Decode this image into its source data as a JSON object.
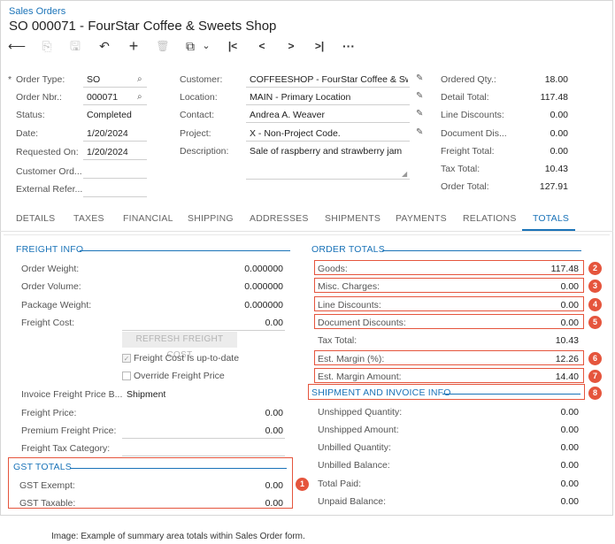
{
  "header": {
    "breadcrumb": "Sales Orders",
    "title": "SO 000071 - FourStar Coffee & Sweets Shop"
  },
  "toolbar": {
    "icons": [
      "back-icon",
      "save-close-icon",
      "save-icon",
      "undo-icon",
      "add-icon",
      "delete-icon",
      "copy-icon",
      "first-icon",
      "previous-icon",
      "next-icon",
      "last-icon",
      "more-icon"
    ],
    "back": "⟵",
    "save_close": "⎘",
    "save": "🖫",
    "undo": "↶",
    "add": "+",
    "delete": "🗑",
    "copy": "⧉",
    "copy_dd": "⌄",
    "first": "|<",
    "prev": "<",
    "next": ">",
    "last": ">|",
    "more": "···"
  },
  "summary": {
    "required_mark": "*",
    "order_type_label": "Order Type:",
    "order_type": "SO",
    "order_nbr_label": "Order Nbr.:",
    "order_nbr": "000071",
    "status_label": "Status:",
    "status": "Completed",
    "date_label": "Date:",
    "date": "1/20/2024",
    "requested_on_label": "Requested On:",
    "requested_on": "1/20/2024",
    "customer_ord_label": "Customer Ord...",
    "external_refer_label": "External Refer...",
    "customer_label": "Customer:",
    "customer": "COFFEESHOP - FourStar Coffee & Swee",
    "location_label": "Location:",
    "location": "MAIN - Primary Location",
    "contact_label": "Contact:",
    "contact": "Andrea A. Weaver",
    "project_label": "Project:",
    "project": "X - Non-Project Code.",
    "description_label": "Description:",
    "description": "Sale of raspberry and strawberry jam",
    "ordered_qty_label": "Ordered Qty.:",
    "ordered_qty": "18.00",
    "detail_total_label": "Detail Total:",
    "detail_total": "117.48",
    "line_discounts_label": "Line Discounts:",
    "line_discounts": "0.00",
    "document_dis_label": "Document Dis...",
    "document_dis": "0.00",
    "freight_total_label": "Freight Total:",
    "freight_total": "0.00",
    "tax_total_label": "Tax Total:",
    "tax_total": "10.43",
    "order_total_label": "Order Total:",
    "order_total": "127.91"
  },
  "tabs": [
    "DETAILS",
    "TAXES",
    "FINANCIAL",
    "SHIPPING",
    "ADDRESSES",
    "SHIPMENTS",
    "PAYMENTS",
    "RELATIONS",
    "TOTALS"
  ],
  "freight": {
    "title": "FREIGHT INFO",
    "order_weight_label": "Order Weight:",
    "order_weight": "0.000000",
    "order_volume_label": "Order Volume:",
    "order_volume": "0.000000",
    "package_weight_label": "Package Weight:",
    "package_weight": "0.000000",
    "freight_cost_label": "Freight Cost:",
    "freight_cost": "0.00",
    "refresh_label": "REFRESH FREIGHT COST",
    "uptodate_label": "Freight Cost Is up-to-date",
    "uptodate_mark": "✓",
    "override_label": "Override Freight Price",
    "invoice_price_label": "Invoice Freight Price B...",
    "invoice_price": "Shipment",
    "freight_price_label": "Freight Price:",
    "freight_price": "0.00",
    "premium_price_label": "Premium Freight Price:",
    "premium_price": "0.00",
    "tax_category_label": "Freight Tax Category:"
  },
  "gst": {
    "title": "GST TOTALS",
    "exempt_label": "GST Exempt:",
    "exempt": "0.00",
    "taxable_label": "GST Taxable:",
    "taxable": "0.00"
  },
  "order_totals": {
    "title": "ORDER TOTALS",
    "goods_label": "Goods:",
    "goods": "117.48",
    "misc_label": "Misc. Charges:",
    "misc": "0.00",
    "line_disc_label": "Line Discounts:",
    "line_disc": "0.00",
    "doc_disc_label": "Document Discounts:",
    "doc_disc": "0.00",
    "tax_total_label": "Tax Total:",
    "tax_total": "10.43",
    "margin_pct_label": "Est. Margin (%):",
    "margin_pct": "12.26",
    "margin_amt_label": "Est. Margin Amount:",
    "margin_amt": "14.40"
  },
  "shipment": {
    "title": "SHIPMENT AND INVOICE INFO",
    "unshipped_qty_label": "Unshipped Quantity:",
    "unshipped_qty": "0.00",
    "unshipped_amt_label": "Unshipped Amount:",
    "unshipped_amt": "0.00",
    "unbilled_qty_label": "Unbilled Quantity:",
    "unbilled_qty": "0.00",
    "unbilled_bal_label": "Unbilled Balance:",
    "unbilled_bal": "0.00",
    "total_paid_label": "Total Paid:",
    "total_paid": "0.00",
    "unpaid_bal_label": "Unpaid Balance:",
    "unpaid_bal": "0.00"
  },
  "callouts": [
    "1",
    "2",
    "3",
    "4",
    "5",
    "6",
    "7",
    "8"
  ],
  "caption": "Image: Example of summary area totals within Sales Order form.",
  "colors": {
    "accent": "#1a73b8",
    "callout": "#e5553d"
  }
}
